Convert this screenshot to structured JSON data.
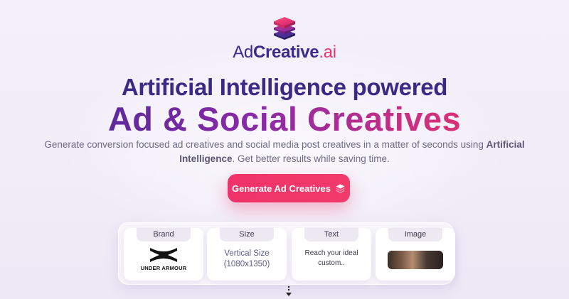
{
  "logo": {
    "part_ad": "Ad",
    "part_creative": "Creative",
    "part_ai": ".ai",
    "icon": "stacked-layers-icon"
  },
  "hero": {
    "line1": "Artificial Intelligence powered",
    "line2": "Ad & Social Creatives",
    "subtitle_1": "Generate conversion focused ad creatives and social media post creatives in a matter of seconds using",
    "subtitle_bold": "Artificial Intelligence",
    "subtitle_2": ". Get better results while saving time."
  },
  "cta": {
    "label": "Generate Ad Creatives",
    "icon": "layers-icon"
  },
  "cards": {
    "brand": {
      "title": "Brand",
      "brand_name": "UNDER ARMOUR"
    },
    "size": {
      "title": "Size",
      "line1": "Vertical Size",
      "line2": "(1080x1350)"
    },
    "text": {
      "title": "Text",
      "line1": "Reach your ideal",
      "line2": "custom.."
    },
    "image": {
      "title": "Image"
    }
  },
  "colors": {
    "primary": "#3a2a86",
    "accent": "#f0336a",
    "background": "#f2eef9"
  }
}
